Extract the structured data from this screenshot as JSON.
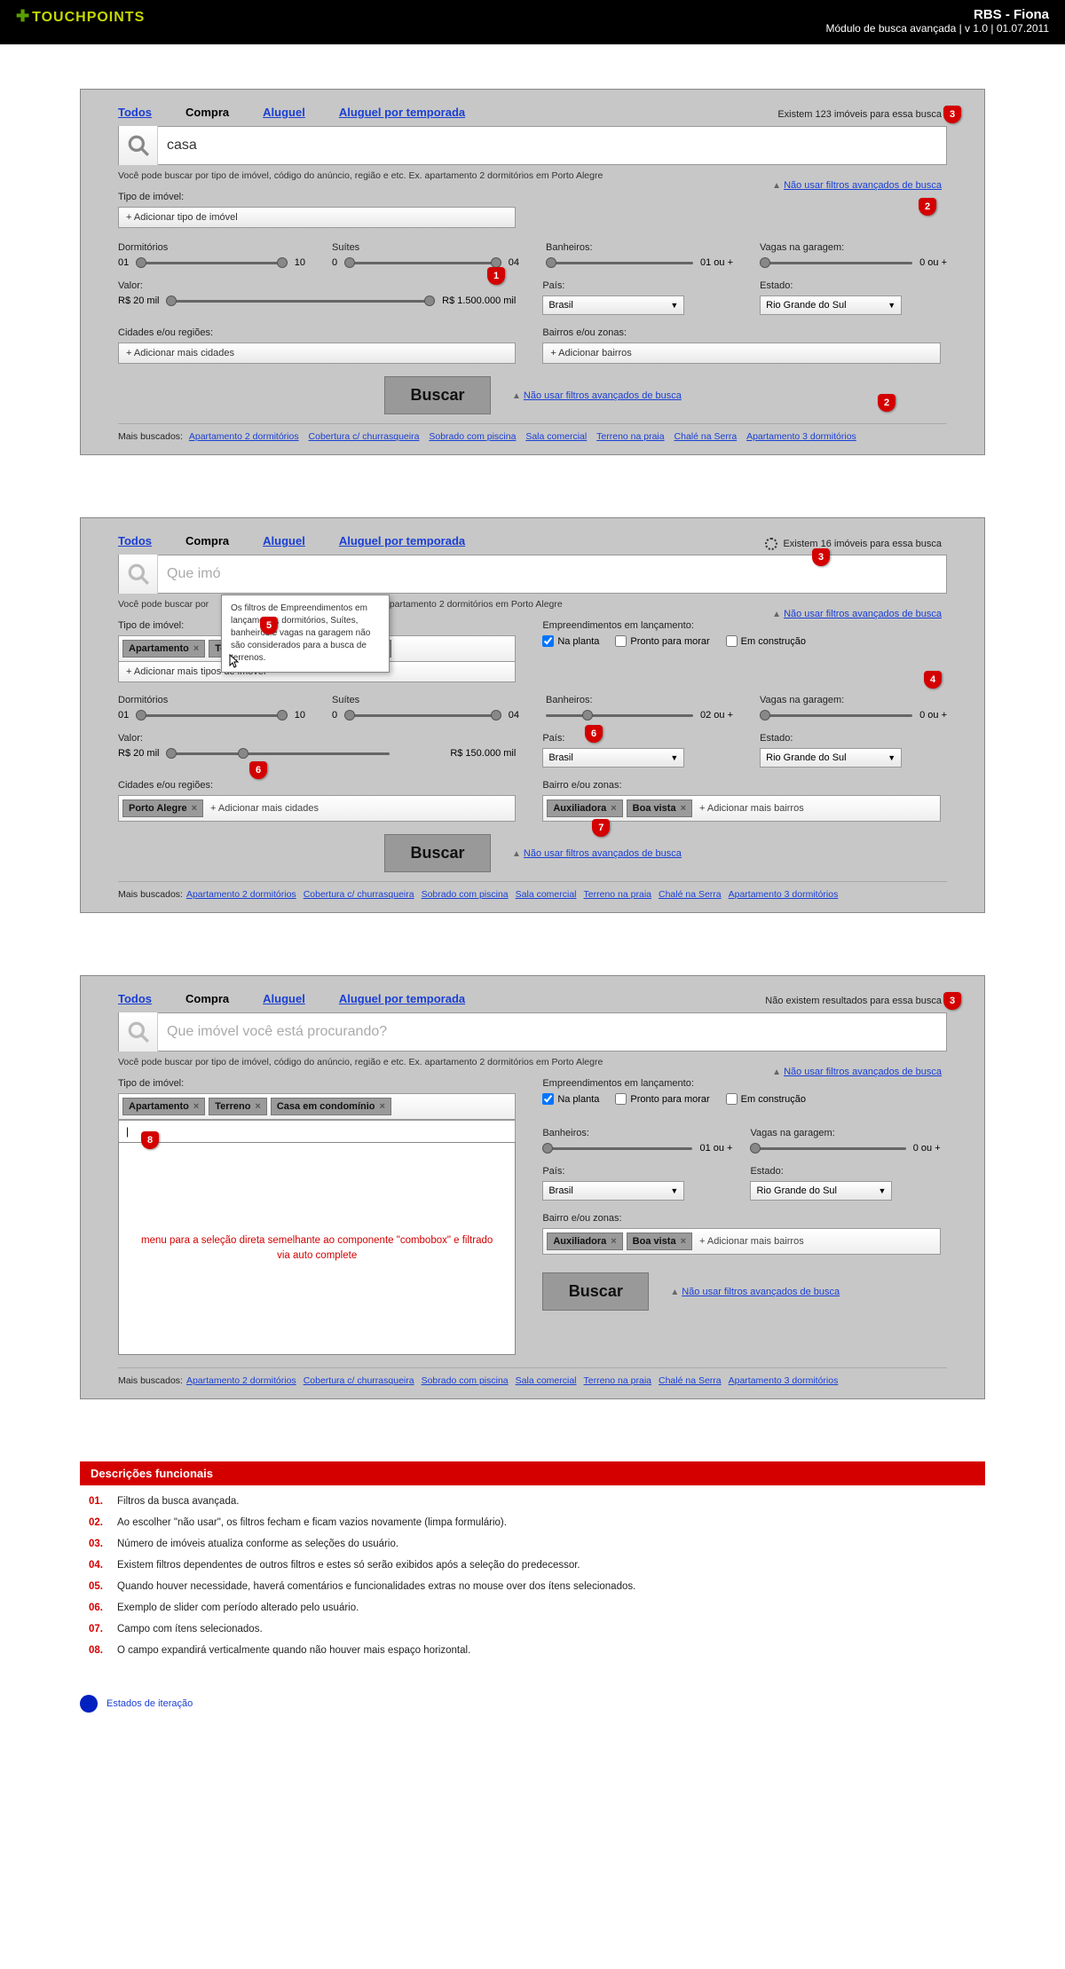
{
  "header": {
    "logo": "TOUCHPOINTS",
    "title": "RBS - Fiona",
    "subtitle": "Módulo de busca avançada | v 1.0 | 01.07.2011"
  },
  "tabs": [
    "Todos",
    "Compra",
    "Aluguel",
    "Aluguel por temporada"
  ],
  "panel1": {
    "results": "Existem 123 imóveis para essa busca",
    "search_value": "casa",
    "advlink": "Não usar filtros avançados de busca",
    "tipo_label": "Tipo de imóvel:",
    "tipo_placeholder": "+ Adicionar tipo de imóvel",
    "dorm_label": "Dormitórios",
    "dorm_min": "01",
    "dorm_max": "10",
    "suites_label": "Suítes",
    "suites_min": "0",
    "suites_max": "04",
    "banh_label": "Banheiros:",
    "banh_max": "01 ou +",
    "vagas_label": "Vagas na garagem:",
    "vagas_max": "0 ou +",
    "valor_label": "Valor:",
    "valor_min": "R$ 20 mil",
    "valor_max": "R$ 1.500.000 mil",
    "pais_label": "País:",
    "pais_value": "Brasil",
    "estado_label": "Estado:",
    "estado_value": "Rio Grande do Sul",
    "cidades_label": "Cidades e/ou regiões:",
    "cidades_placeholder": "+ Adicionar mais cidades",
    "bairros_label": "Bairros e/ou zonas:",
    "bairros_placeholder": "+ Adicionar bairros",
    "buscar": "Buscar"
  },
  "panel2": {
    "results": "Existem 16 imóveis para essa busca",
    "tooltip": "Os filtros de Empreendimentos em lançamento, dormitórios, Suítes, banheiros e vagas na garagem não são considerados para a busca de terrenos.",
    "search_placeholder": "Que imó",
    "tokens": [
      "Apartamento",
      "Terreno",
      "Casa em condomínio"
    ],
    "addmore_tipos": "+ Adicionar mais tipos de imóvel",
    "empr_label": "Empreendimentos em lançamento:",
    "chk1": "Na planta",
    "chk2": "Pronto para morar",
    "chk3": "Em construção",
    "banh_max": "02 ou +",
    "valor_max": "R$ 150.000 mil",
    "cidade_token": "Porto Alegre",
    "cidade_add": "+ Adicionar mais cidades",
    "bairro_label": "Bairro e/ou zonas:",
    "bairro_tokens": [
      "Auxiliadora",
      "Boa vista"
    ],
    "bairro_add": "+ Adicionar mais bairros"
  },
  "panel3": {
    "results": "Não existem resultados para essa busca",
    "search_placeholder": "Que imóvel você está procurando?",
    "menu_text": "menu para a seleção direta semelhante ao componente \"combobox\" e filtrado via auto complete"
  },
  "hint": "Você pode buscar por tipo de imóvel, código do anúncio, região e etc. Ex. apartamento 2 dormitórios em Porto Alegre",
  "hint_short": "Você pode buscar por",
  "hint_mid": "o e etc. Ex. apartamento 2 dormitórios em Porto Alegre",
  "mais_label": "Mais buscados:",
  "mais_links": [
    "Apartamento 2 dormitórios",
    "Cobertura c/ churrasqueira",
    "Sobrado com piscina",
    "Sala comercial",
    "Terreno na praia",
    "Chalé na Serra",
    "Apartamento 3 dormitórios"
  ],
  "desc_header": "Descrições funcionais",
  "descs": [
    "Filtros da busca avançada.",
    "Ao escolher \"não usar\", os filtros fecham e ficam vazios novamente (limpa formulário).",
    "Número de imóveis atualiza conforme as seleções do usuário.",
    "Existem filtros dependentes de outros filtros e estes só serão exibidos após a seleção do predecessor.",
    "Quando houver necessidade, haverá comentários e funcionalidades extras no mouse over dos ítens selecionados.",
    "Exemplo de slider com período alterado pelo usuário.",
    "Campo com ítens selecionados.",
    "O campo expandirá verticalmente quando não houver mais espaço horizontal."
  ],
  "legend": "Estados de iteração"
}
